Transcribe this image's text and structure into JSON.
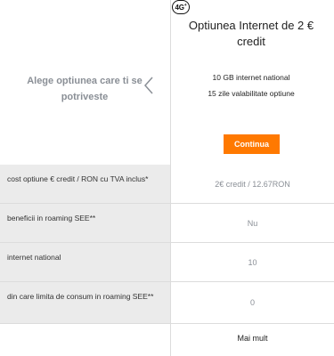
{
  "selector": {
    "prompt": "Alege optiunea care ti se potriveste"
  },
  "offer": {
    "badge": "4G",
    "badge_sup": "+",
    "title": "Optiunea Internet de 2 € credit",
    "features": [
      "10 GB internet national",
      "15 zile valabilitate optiune"
    ],
    "cta_label": "Continua"
  },
  "table": {
    "rows": [
      {
        "label": "cost optiune € credit / RON cu TVA inclus*",
        "value": "2€ credit / 12.67RON"
      },
      {
        "label": "beneficii in roaming SEE**",
        "value": "Nu"
      },
      {
        "label": "internet national",
        "value": "10"
      },
      {
        "label": "din care limita de consum in roaming SEE**",
        "value": "0"
      }
    ]
  },
  "more_label": "Mai mult",
  "colors": {
    "accent": "#ff7900",
    "label_bg": "#ebebeb",
    "muted_text": "#8a8f96"
  }
}
